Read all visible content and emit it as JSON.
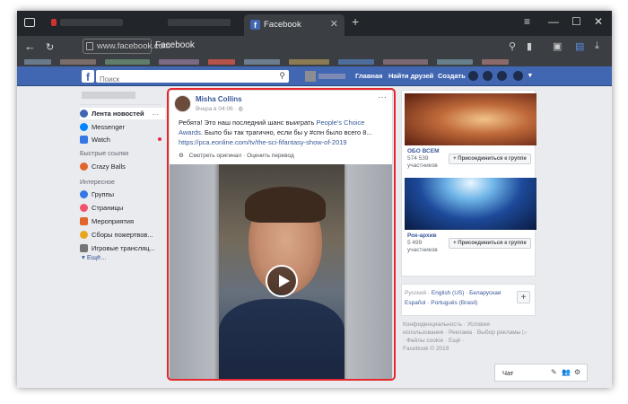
{
  "browser": {
    "tab_title": "Facebook",
    "new_tab": "+",
    "window_controls": [
      "≡",
      "—",
      "☐",
      "✕"
    ],
    "url": "www.facebook.com",
    "page_title": "Facebook",
    "tab_close": "✕"
  },
  "fb_header": {
    "logo": "f",
    "search_placeholder": "Поиск",
    "nav": [
      "Главная",
      "Найти друзей",
      "Создать"
    ]
  },
  "left_sidebar": {
    "items": [
      {
        "label": "Лента новостей",
        "color": "#4267b2"
      },
      {
        "label": "Messenger",
        "color": "#0084ff"
      },
      {
        "label": "Watch",
        "color": "#3578e5"
      }
    ],
    "shortcuts_heading": "Быстрые ссылки",
    "shortcuts": [
      {
        "label": "Crazy Balls",
        "color": "#e0662e"
      }
    ],
    "explore_heading": "Интересное",
    "explore": [
      {
        "label": "Группы",
        "color": "#3578e5"
      },
      {
        "label": "Страницы",
        "color": "#f25268"
      },
      {
        "label": "Мероприятия",
        "color": "#e0662e"
      },
      {
        "label": "Сборы пожертвов...",
        "color": "#e9a520"
      },
      {
        "label": "Игровые трансляц...",
        "color": "#767676"
      }
    ],
    "more": "▾ Ещё..."
  },
  "post": {
    "author": "Misha Collins",
    "time": "Вчера в 04:06 · ◍",
    "menu": "···",
    "text_prefix": "Ребята! Это наш последний шанс выиграть ",
    "text_link": "People's Choice Awards",
    "text_suffix": ". Было бы так трагично, если бы у #спн было всего 8...",
    "url": "https://pca.eonline.com/tv/the-sci-fifantasy-show-of-2019",
    "translate_gear": "⚙",
    "translate_original": "Смотреть оригинал",
    "translate_separator": " · ",
    "translate_rate": "Оценить перевод"
  },
  "groups": [
    {
      "name": "ОБО ВСЕМ",
      "members": "574 539",
      "members_label": "участников",
      "join": "+ Присоединиться к группе"
    },
    {
      "name": "Рок-архив",
      "members": "5 499",
      "members_label": "участников",
      "join": "+ Присоединиться к группе"
    }
  ],
  "languages": {
    "line1_current": "Русский",
    "line1_rest": " · English (US) · Беларуская",
    "line2": "Español · Português (Brasil)",
    "add": "+"
  },
  "footer": {
    "line1": "Конфиденциальность · Условия",
    "line2": "использования · Реклама · Выбор рекламы ▷",
    "line3": "· Файлы cookie · Ещё ·",
    "line4": "Facebook © 2019"
  },
  "chat": {
    "label": "Чат",
    "icons": [
      "✎",
      "👥",
      "⚙"
    ]
  }
}
